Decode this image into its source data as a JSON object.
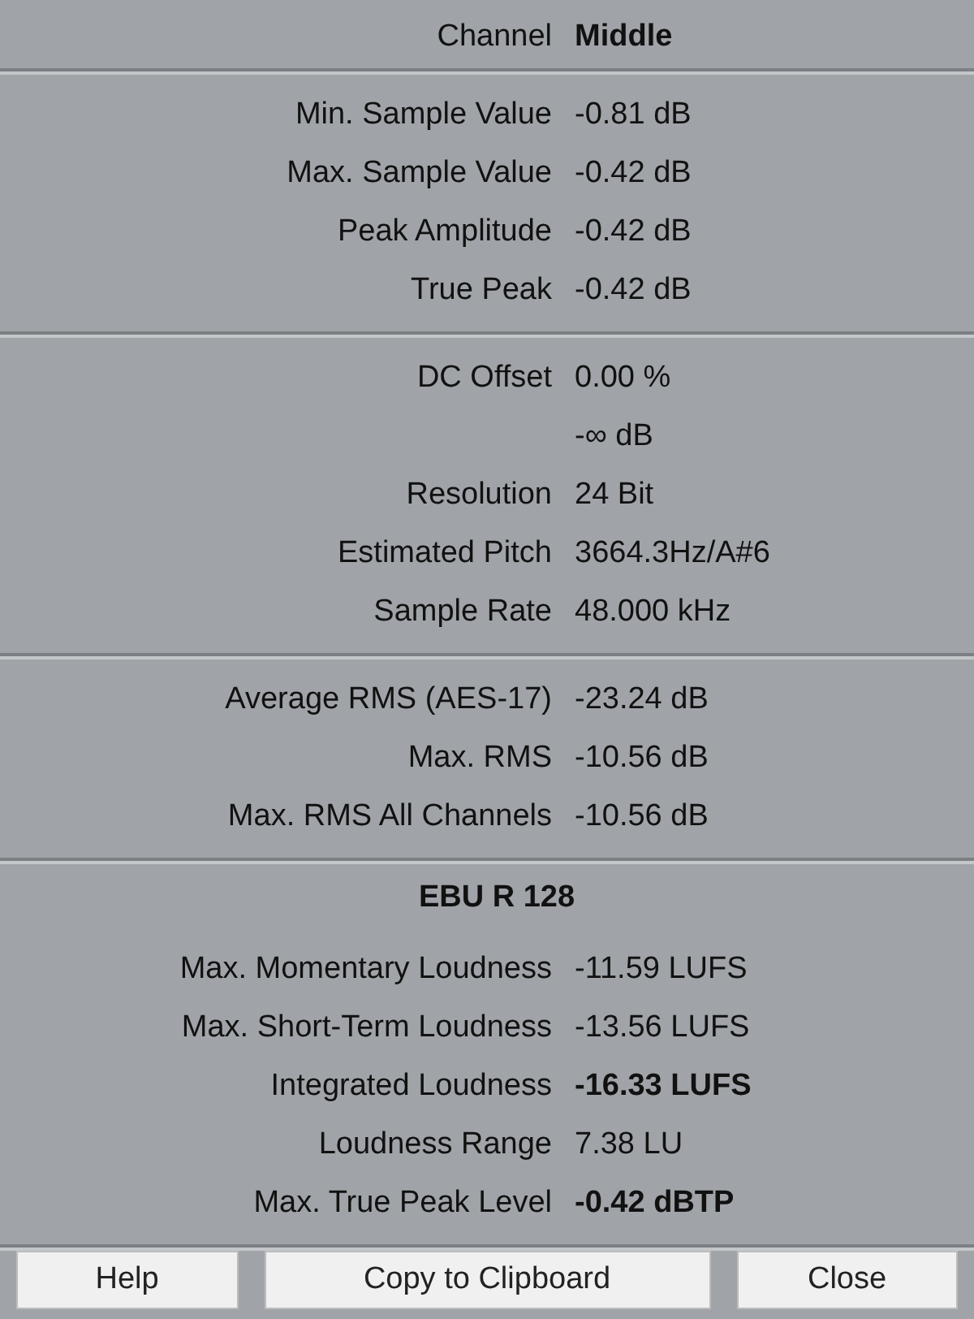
{
  "channel": {
    "label": "Channel",
    "value": "Middle"
  },
  "sections": [
    {
      "rows": [
        {
          "label": "Min. Sample Value",
          "value": "-0.81 dB",
          "bold": false
        },
        {
          "label": "Max. Sample Value",
          "value": "-0.42 dB",
          "bold": false
        },
        {
          "label": "Peak Amplitude",
          "value": "-0.42 dB",
          "bold": false
        },
        {
          "label": "True Peak",
          "value": "-0.42 dB",
          "bold": false
        }
      ]
    },
    {
      "rows": [
        {
          "label": "DC Offset",
          "value": "0.00 %",
          "bold": false
        },
        {
          "value": "-∞ dB",
          "bold": false
        },
        {
          "label": "Resolution",
          "value": "24 Bit",
          "bold": false
        },
        {
          "label": "Estimated Pitch",
          "value": "3664.3Hz/A#6",
          "bold": false
        },
        {
          "label": "Sample Rate",
          "value": "48.000 kHz",
          "bold": false
        }
      ]
    },
    {
      "rows": [
        {
          "label": "Average RMS (AES-17)",
          "value": "-23.24 dB",
          "bold": false
        },
        {
          "label": "Max. RMS",
          "value": "-10.56 dB",
          "bold": false
        },
        {
          "label": "Max. RMS All Channels",
          "value": "-10.56 dB",
          "bold": false
        }
      ]
    },
    {
      "title": "EBU R 128",
      "rows": [
        {
          "label": "Max. Momentary Loudness",
          "value": "-11.59 LUFS",
          "bold": false
        },
        {
          "label": "Max. Short-Term Loudness",
          "value": "-13.56 LUFS",
          "bold": false
        },
        {
          "label": "Integrated Loudness",
          "value": "-16.33 LUFS",
          "bold": true
        },
        {
          "label": "Loudness Range",
          "value": "7.38 LU",
          "bold": false
        },
        {
          "label": "Max. True Peak Level",
          "value": "-0.42 dBTP",
          "bold": true
        }
      ]
    }
  ],
  "buttons": [
    "Help",
    "Copy to Clipboard",
    "Close"
  ]
}
